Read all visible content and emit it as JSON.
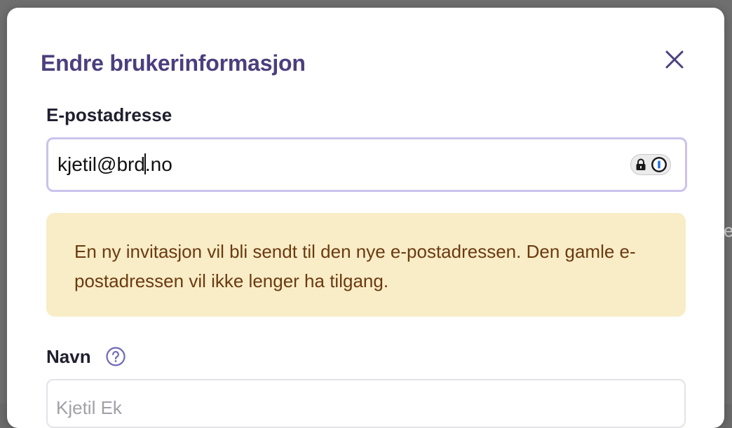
{
  "modal": {
    "title": "Endre brukerinformasjon",
    "close_icon": "close-icon"
  },
  "background": {
    "partial_char": "e"
  },
  "email": {
    "label": "E-postadresse",
    "value_before_caret": "kjetil@brd",
    "value_after_caret": ".no",
    "password_manager_icons": [
      "lock-icon",
      "1password-icon"
    ]
  },
  "notice": {
    "text": "En ny invitasjon vil bli sendt til den nye e-postadressen. Den gamle e-postadressen vil ikke lenger ha tilgang."
  },
  "name": {
    "label": "Navn",
    "help_icon": "question-circle-icon",
    "placeholder": "Kjetil Ek"
  },
  "colors": {
    "title": "#4b3f7e",
    "input_focus_border": "#cbc2ec",
    "notice_bg": "#f8edc7",
    "notice_text": "#6b3a12",
    "help_icon": "#6f68b8"
  }
}
